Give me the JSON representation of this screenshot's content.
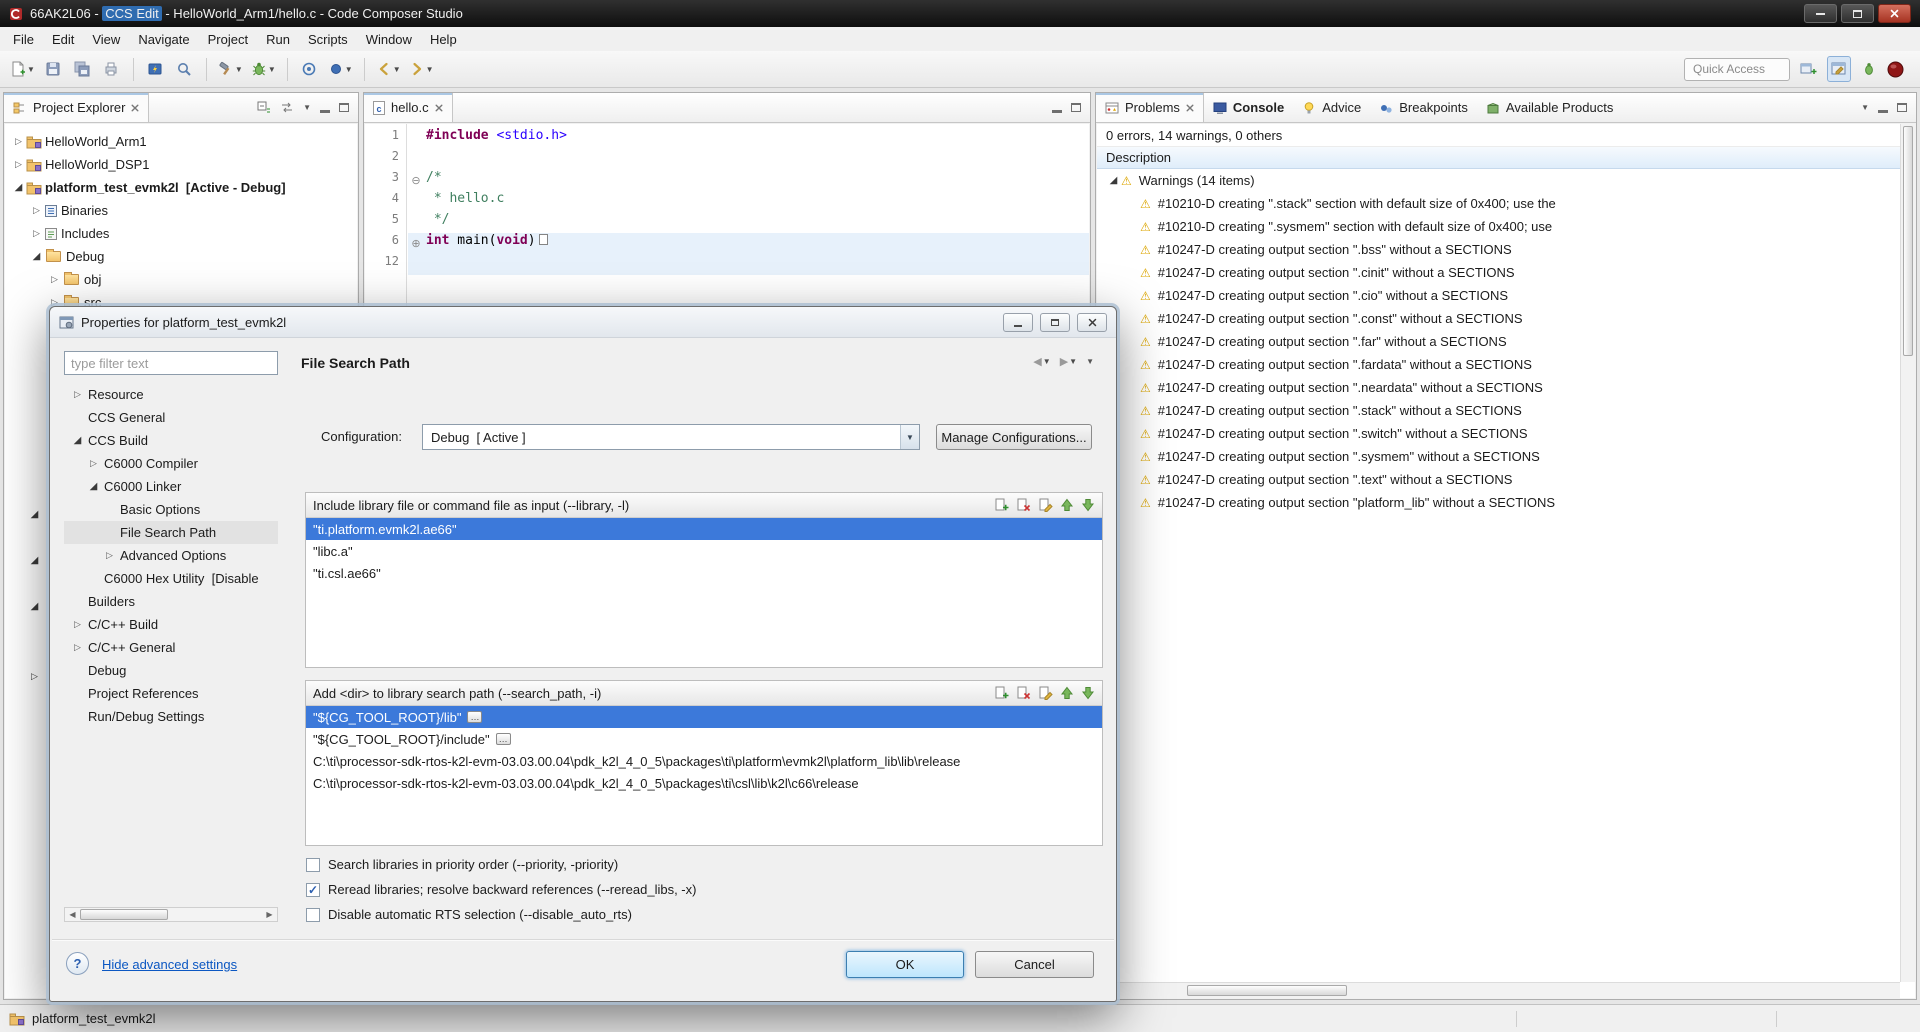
{
  "titlebar": {
    "title_pre": "66AK2L06 - ",
    "title_highlight": "CCS Edit",
    "title_post": " - HelloWorld_Arm1/hello.c - Code Composer Studio"
  },
  "menubar": {
    "items": [
      "File",
      "Edit",
      "View",
      "Navigate",
      "Project",
      "Run",
      "Scripts",
      "Window",
      "Help"
    ]
  },
  "toolbar": {
    "quick_access": "Quick Access"
  },
  "explorer": {
    "tab_label": "Project Explorer",
    "items": [
      {
        "label": "HelloWorld_Arm1"
      },
      {
        "label": "HelloWorld_DSP1"
      },
      {
        "label": "platform_test_evmk2l  [Active - Debug]"
      },
      {
        "label": "Binaries"
      },
      {
        "label": "Includes"
      },
      {
        "label": "Debug"
      },
      {
        "label": "obj"
      },
      {
        "label": "src"
      }
    ]
  },
  "editor": {
    "tab_label": "hello.c",
    "line_numbers": [
      "1",
      "2",
      "3",
      "4",
      "5",
      "6",
      "12"
    ],
    "code": {
      "include_directive": "#include",
      "include_header": " <stdio.h>",
      "comment_open": "/*",
      "comment_body": " * hello.c",
      "comment_close": " */",
      "kw_int": "int",
      "fn_main": " main(",
      "kw_void": "void",
      "paren_close": ")"
    }
  },
  "problems": {
    "tabs": [
      "Problems",
      "Console",
      "Advice",
      "Breakpoints",
      "Available Products"
    ],
    "summary": "0 errors, 14 warnings, 0 others",
    "column_header": "Description",
    "group_label": "Warnings (14 items)",
    "warnings": [
      "#10210-D creating \".stack\" section with default size of 0x400; use the",
      "#10210-D creating \".sysmem\" section with default size of 0x400; use",
      "#10247-D creating output section \".bss\" without a SECTIONS",
      "#10247-D creating output section \".cinit\" without a SECTIONS",
      "#10247-D creating output section \".cio\" without a SECTIONS",
      "#10247-D creating output section \".const\" without a SECTIONS",
      "#10247-D creating output section \".far\" without a SECTIONS",
      "#10247-D creating output section \".fardata\" without a SECTIONS",
      "#10247-D creating output section \".neardata\" without a SECTIONS",
      "#10247-D creating output section \".stack\" without a SECTIONS",
      "#10247-D creating output section \".switch\" without a SECTIONS",
      "#10247-D creating output section \".sysmem\" without a SECTIONS",
      "#10247-D creating output section \".text\" without a SECTIONS",
      "#10247-D creating output section \"platform_lib\" without a SECTIONS"
    ]
  },
  "dialog": {
    "title": "Properties for platform_test_evmk2l",
    "filter_placeholder": "type filter text",
    "tree": [
      {
        "label": "Resource"
      },
      {
        "label": "CCS General"
      },
      {
        "label": "CCS Build"
      },
      {
        "label": "C6000 Compiler"
      },
      {
        "label": "C6000 Linker"
      },
      {
        "label": "Basic Options"
      },
      {
        "label": "File Search Path"
      },
      {
        "label": "Advanced Options"
      },
      {
        "label": "C6000 Hex Utility  [Disable"
      },
      {
        "label": "Builders"
      },
      {
        "label": "C/C++ Build"
      },
      {
        "label": "C/C++ General"
      },
      {
        "label": "Debug"
      },
      {
        "label": "Project References"
      },
      {
        "label": "Run/Debug Settings"
      }
    ],
    "page_title": "File Search Path",
    "configuration": {
      "label": "Configuration:",
      "value": "Debug  [ Active ]",
      "manage_button": "Manage Configurations..."
    },
    "include_group": {
      "title": "Include library file or command file as input (--library, -l)",
      "items": [
        "\"ti.platform.evmk2l.ae66\"",
        "\"libc.a\"",
        "\"ti.csl.ae66\""
      ]
    },
    "searchpath_group": {
      "title": "Add <dir> to library search path (--search_path, -i)",
      "items": [
        "\"${CG_TOOL_ROOT}/lib\"",
        "\"${CG_TOOL_ROOT}/include\"",
        "C:\\ti\\processor-sdk-rtos-k2l-evm-03.03.00.04\\pdk_k2l_4_0_5\\packages\\ti\\platform\\evmk2l\\platform_lib\\lib\\release",
        "C:\\ti\\processor-sdk-rtos-k2l-evm-03.03.00.04\\pdk_k2l_4_0_5\\packages\\ti\\csl\\lib\\k2l\\c66\\release"
      ]
    },
    "options": [
      {
        "label": "Search libraries in priority order (--priority, -priority)",
        "checked": false
      },
      {
        "label": "Reread libraries; resolve backward references (--reread_libs, -x)",
        "checked": true
      },
      {
        "label": "Disable automatic RTS selection (--disable_auto_rts)",
        "checked": false
      }
    ],
    "hide_advanced_link": "Hide advanced settings",
    "ok_button": "OK",
    "cancel_button": "Cancel"
  },
  "statusbar": {
    "text": "platform_test_evmk2l"
  }
}
